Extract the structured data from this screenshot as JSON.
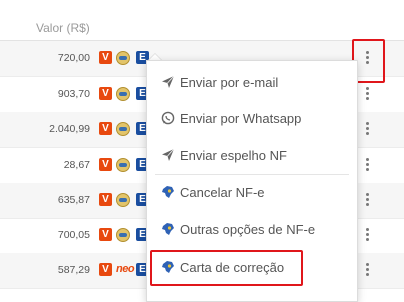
{
  "header": {
    "value_label": "Valor (R$)"
  },
  "rows": [
    {
      "value": "720,00",
      "second_badge": "coin"
    },
    {
      "value": "903,70",
      "second_badge": "coin"
    },
    {
      "value": "2.040,99",
      "second_badge": "coin"
    },
    {
      "value": "28,67",
      "second_badge": "coin"
    },
    {
      "value": "635,87",
      "second_badge": "coin"
    },
    {
      "value": "700,05",
      "second_badge": "coin"
    },
    {
      "value": "587,29",
      "second_badge": "neo"
    }
  ],
  "badges": {
    "v": "V",
    "e": "E",
    "neo": "neo"
  },
  "menu": {
    "items": [
      {
        "label": "Enviar por e-mail",
        "icon": "send-icon"
      },
      {
        "label": "Enviar por Whatsapp",
        "icon": "whatsapp-icon"
      },
      {
        "label": "Enviar espelho NF",
        "icon": "send-icon"
      },
      {
        "label": "Cancelar NF-e",
        "icon": "brazil-map-icon"
      },
      {
        "label": "Outras opções de NF-e",
        "icon": "brazil-map-icon"
      },
      {
        "label": "Carta de correção",
        "icon": "brazil-map-icon"
      }
    ]
  },
  "colors": {
    "highlight": "#e0161b",
    "badge_v": "#e8490f",
    "badge_e": "#1a4ea0",
    "row_alt": "#f6f6f6"
  }
}
